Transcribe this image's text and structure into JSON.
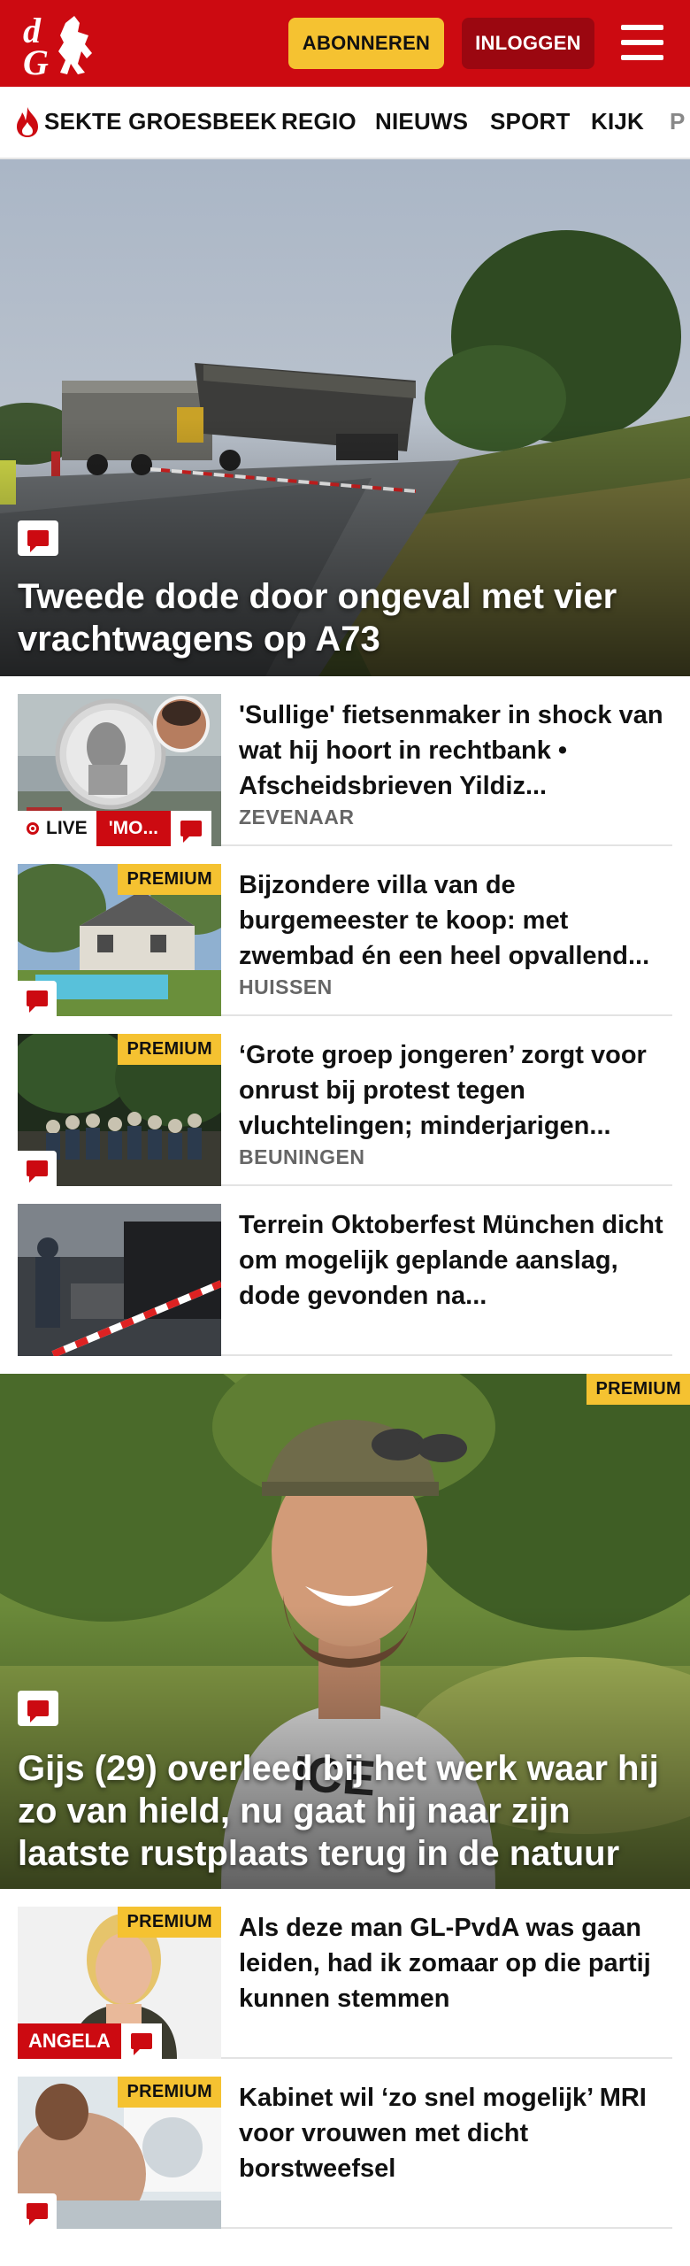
{
  "header": {
    "logo_text": "dG",
    "subscribe_label": "ABONNEREN",
    "login_label": "INLOGGEN"
  },
  "nav": {
    "items": [
      "SEKTE GROESBEEK",
      "REGIO",
      "NIEUWS",
      "SPORT",
      "KIJK",
      "P"
    ]
  },
  "hero1": {
    "title": "Tweede dode door ongeval met vier vrachtwagens op A73"
  },
  "articles": [
    {
      "title": "'Sullige' fietsenmaker in shock van wat hij hoort in rechtbank • Afscheidsbrieven Yildiz...",
      "location": "ZEVENAAR",
      "live_label": "LIVE",
      "live_tag": "'MO..."
    },
    {
      "title": "Bijzondere villa van de burgemeester te koop: met zwembad én een heel opvallend...",
      "location": "HUISSEN",
      "badge": "PREMIUM"
    },
    {
      "title": "‘Grote groep jongeren’ zorgt voor onrust bij protest tegen vluchtelingen; minderjarigen...",
      "location": "BEUNINGEN",
      "badge": "PREMIUM"
    },
    {
      "title": "Terrein Oktoberfest München dicht om mogelijk geplande aanslag, dode gevonden na..."
    }
  ],
  "hero2": {
    "title": "Gijs (29) overleed bij het werk waar hij zo van hield, nu gaat hij naar zijn laatste rustplaats terug in de natuur",
    "badge": "PREMIUM"
  },
  "articles2": [
    {
      "title": "Als deze man GL-PvdA was gaan leiden, had ik zomaar op die partij kunnen stemmen",
      "badge": "PREMIUM",
      "author_tag": "ANGELA"
    },
    {
      "title": "Kabinet wil ‘zo snel mogelijk’ MRI voor vrouwen met dicht borstweefsel",
      "badge": "PREMIUM"
    }
  ],
  "colors": {
    "brand_red": "#cc0a11",
    "subscribe_yellow": "#f5c231",
    "login_darkred": "#9b0710",
    "premium_yellow": "#f5c231"
  },
  "icons": [
    "flame-icon",
    "menu-icon",
    "comment-icon",
    "live-dot-icon"
  ]
}
